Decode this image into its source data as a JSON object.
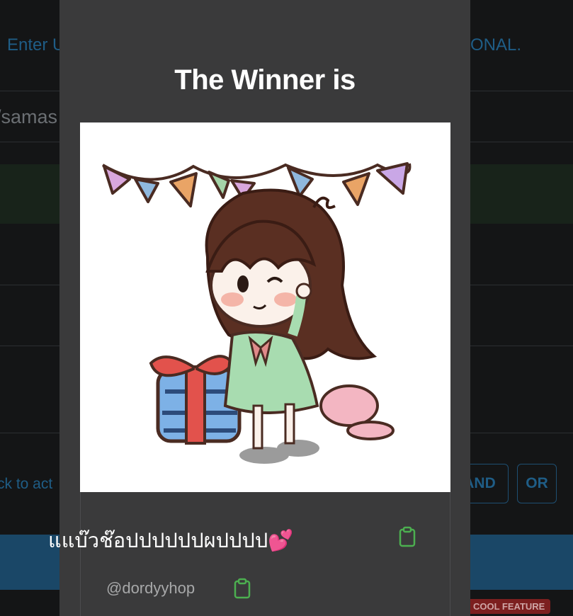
{
  "background": {
    "instruction_left": "Enter U",
    "instruction_right": "ONAL.",
    "url_fragment": "/samas",
    "back_text": "ck to act",
    "and_button": "AND",
    "or_button": "OR",
    "feature_badge": "COOL FEATURE"
  },
  "modal": {
    "title": "The Winner is",
    "winner": {
      "display_name": "แแบ๊วช๊อปปปปปปผปปปป💕",
      "handle": "@dordyyhop"
    },
    "image": {
      "description_icon": "avatar-image"
    }
  },
  "colors": {
    "modal_bg": "#3a3a3b",
    "page_bg": "#141516",
    "accent_blue": "#1f5d86",
    "copy_green": "#4caf50"
  }
}
